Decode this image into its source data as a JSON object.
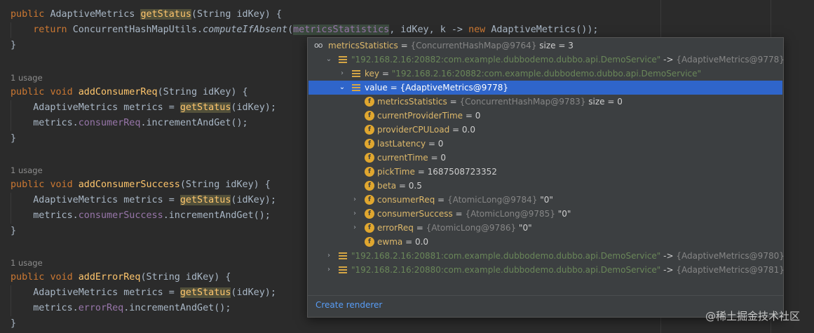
{
  "code": {
    "lines": [
      "public AdaptiveMetrics getStatus(String idKey) {",
      "    return ConcurrentHashMapUtils.computeIfAbsent(metricsStatistics, idKey, k -> new AdaptiveMetrics());",
      "}",
      "1 usage",
      "public void addConsumerReq(String idKey) {",
      "    AdaptiveMetrics metrics = getStatus(idKey);",
      "    metrics.consumerReq.incrementAndGet();",
      "}",
      "1 usage",
      "public void addConsumerSuccess(String idKey) {",
      "    AdaptiveMetrics metrics = getStatus(idKey);",
      "    metrics.consumerSuccess.incrementAndGet();",
      "}",
      "1 usage",
      "public void addErrorReq(String idKey) {",
      "    AdaptiveMetrics metrics = getStatus(idKey);",
      "    metrics.errorReq.incrementAndGet();",
      "}"
    ]
  },
  "tokens": {
    "public": "public",
    "void": "void",
    "return": "return",
    "new": "new",
    "AdaptiveMetrics": "AdaptiveMetrics",
    "getStatus": "getStatus",
    "params": "(String idKey) {",
    "ConcurrentHashMapUtils": "ConcurrentHashMapUtils.",
    "computeIfAbsent": "computeIfAbsent",
    "metricsStatistics": "metricsStatistics",
    "idKey_k": ", idKey, k -> ",
    "ctor": "AdaptiveMetrics());",
    "brace_close": "}",
    "metrics_decl": "AdaptiveMetrics metrics = ",
    "idKey_call": "(idKey);",
    "usage": "1 usage",
    "addConsumerReq": "addConsumerReq",
    "addConsumerSuccess": "addConsumerSuccess",
    "addErrorReq": "addErrorReq",
    "metrics_dot": "metrics.",
    "consumerReq": "consumerReq",
    "consumerSuccess": "consumerSuccess",
    "errorReq": "errorReq",
    "increment": ".incrementAndGet();"
  },
  "debug_popup": {
    "root": {
      "name": "metricsStatistics",
      "value": "{ConcurrentHashMap@9764}",
      "size": "size = 3"
    },
    "entries": [
      {
        "key": "\"192.168.2.16:20882:com.example.dubbodemo.dubbo.api.DemoService\"",
        "arrow": "->",
        "value": "{AdaptiveMetrics@9778}"
      },
      {
        "key": "\"192.168.2.16:20881:com.example.dubbodemo.dubbo.api.DemoService\"",
        "arrow": "->",
        "value": "{AdaptiveMetrics@9780}"
      },
      {
        "key": "\"192.168.2.16:20880:com.example.dubbodemo.dubbo.api.DemoService\"",
        "arrow": "->",
        "value": "{AdaptiveMetrics@9781}"
      }
    ],
    "key_row": {
      "name": "key",
      "eq": "=",
      "value": "\"192.168.2.16:20882:com.example.dubbodemo.dubbo.api.DemoService\""
    },
    "value_row": {
      "name": "value",
      "eq": "=",
      "value": "{AdaptiveMetrics@9778}"
    },
    "fields": [
      {
        "name": "metricsStatistics",
        "eq": "=",
        "ref": "{ConcurrentHashMap@9783}",
        "val": "size = 0"
      },
      {
        "name": "currentProviderTime",
        "eq": "=",
        "ref": "",
        "val": "0"
      },
      {
        "name": "providerCPULoad",
        "eq": "=",
        "ref": "",
        "val": "0.0"
      },
      {
        "name": "lastLatency",
        "eq": "=",
        "ref": "",
        "val": "0"
      },
      {
        "name": "currentTime",
        "eq": "=",
        "ref": "",
        "val": "0"
      },
      {
        "name": "pickTime",
        "eq": "=",
        "ref": "",
        "val": "1687508723352"
      },
      {
        "name": "beta",
        "eq": "=",
        "ref": "",
        "val": "0.5"
      },
      {
        "name": "consumerReq",
        "eq": "=",
        "ref": "{AtomicLong@9784}",
        "val": "\"0\""
      },
      {
        "name": "consumerSuccess",
        "eq": "=",
        "ref": "{AtomicLong@9785}",
        "val": "\"0\""
      },
      {
        "name": "errorReq",
        "eq": "=",
        "ref": "{AtomicLong@9786}",
        "val": "\"0\""
      },
      {
        "name": "ewma",
        "eq": "=",
        "ref": "",
        "val": "0.0"
      }
    ],
    "field_icon": "f",
    "create_renderer": "Create renderer"
  },
  "watermark": "@稀土掘金技术社区",
  "colors": {
    "background": "#2b2b2b",
    "keyword": "#cc7832",
    "function": "#ffc66d",
    "field": "#9876aa",
    "string": "#6a8759",
    "selection": "#2f65ca",
    "link": "#589df6"
  },
  "icons": {
    "watch": "glasses-icon",
    "entry": "map-entry-icon",
    "field": "field-icon",
    "expand": "chevron-down-icon",
    "collapse": "chevron-right-icon"
  }
}
